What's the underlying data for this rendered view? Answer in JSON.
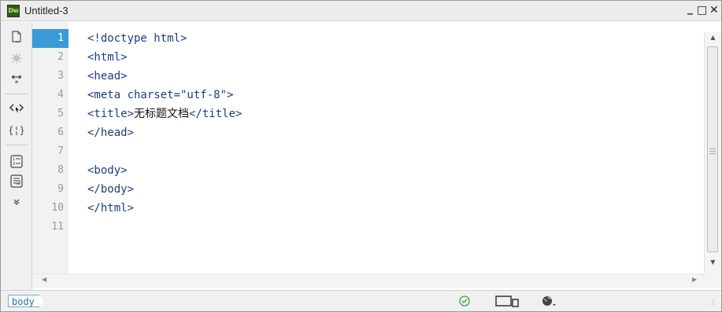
{
  "window": {
    "title": "Untitled-3",
    "app_icon_label": "Dw",
    "controls": {
      "minimize": "_",
      "maximize": "□",
      "close": "✕"
    }
  },
  "toolbar": {
    "items": [
      {
        "name": "open-documents-icon",
        "glyph": "🗋"
      },
      {
        "name": "file-management-icon",
        "glyph": "✳"
      },
      {
        "name": "expand-collapse-icon",
        "glyph": "↔"
      },
      {
        "name": "select-parent-tag-icon",
        "glyph": "<>"
      },
      {
        "name": "balance-braces-icon",
        "glyph": "{ }"
      },
      {
        "name": "line-numbers-icon",
        "glyph": "1 2"
      },
      {
        "name": "word-wrap-icon",
        "glyph": "↵"
      },
      {
        "name": "more-tools-icon",
        "glyph": "»"
      }
    ]
  },
  "editor": {
    "active_line": 1,
    "line_numbers": [
      "1",
      "2",
      "3",
      "4",
      "5",
      "6",
      "7",
      "8",
      "9",
      "10",
      "11"
    ],
    "lines": [
      "<!doctype html>",
      "<html>",
      "<head>",
      "<meta charset=\"utf-8\">",
      {
        "before": "<title>",
        "text": "无标题文档",
        "after": "</title>"
      },
      "</head>",
      "",
      "<body>",
      "</body>",
      "</html>",
      ""
    ]
  },
  "statusbar": {
    "tag_selector": "body",
    "icons": [
      "valid-check-icon",
      "device-preview-icon",
      "live-view-globe-icon"
    ]
  }
}
